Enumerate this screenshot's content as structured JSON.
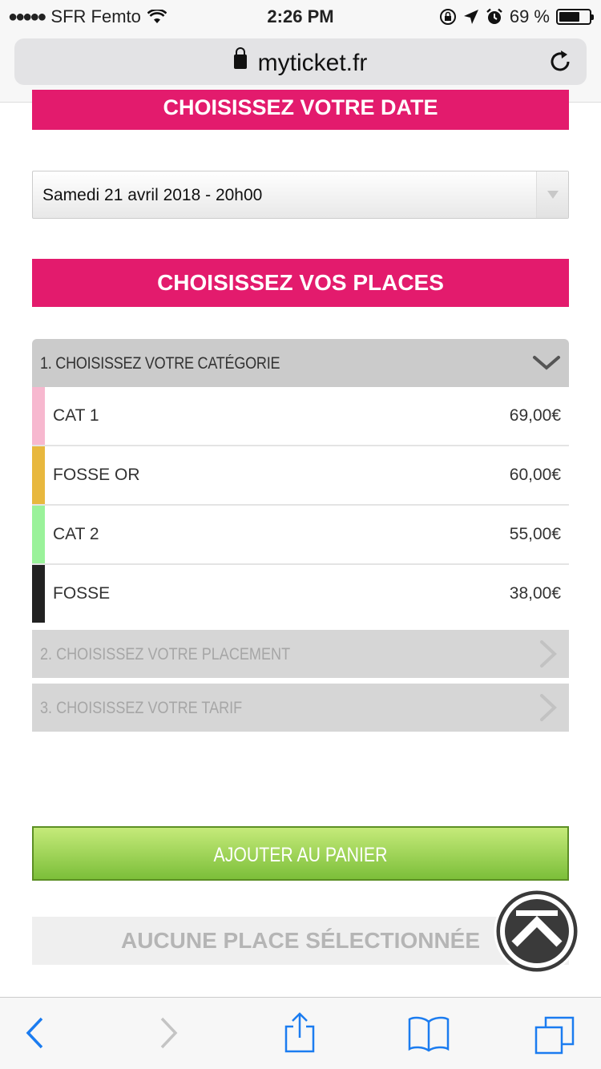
{
  "status_bar": {
    "carrier": "SFR Femto",
    "time": "2:26 PM",
    "battery_percent": "69 %",
    "battery_level": 0.69
  },
  "browser": {
    "url": "myticket.fr"
  },
  "page": {
    "date_header": "CHOISISSEZ VOTRE DATE",
    "date_select_value": "Samedi 21 avril 2018 - 20h00",
    "places_header": "CHOISISSEZ VOS PLACES",
    "step1_label": "1. CHOISISSEZ VOTRE CATÉGORIE",
    "categories": [
      {
        "name": "CAT 1",
        "price": "69,00€",
        "color": "#f7b8cf"
      },
      {
        "name": "FOSSE OR",
        "price": "60,00€",
        "color": "#e8b83e"
      },
      {
        "name": "CAT 2",
        "price": "55,00€",
        "color": "#9af29a"
      },
      {
        "name": "FOSSE",
        "price": "38,00€",
        "color": "#222222"
      }
    ],
    "step2_label": "2. CHOISISSEZ VOTRE PLACEMENT",
    "step3_label": "3. CHOISISSEZ VOTRE TARIF",
    "add_to_cart_label": "AJOUTER AU PANIER",
    "no_seat_label": "AUCUNE PLACE SÉLECTIONNÉE"
  },
  "colors": {
    "accent_pink": "#e31b6d",
    "cart_green": "#7cbf3a",
    "ios_blue": "#1b7cf0"
  },
  "icons": {
    "back": "chevron-left-icon",
    "forward": "chevron-right-icon",
    "share": "share-icon",
    "bookmarks": "book-icon",
    "tabs": "tabs-icon",
    "scroll_top": "scroll-to-top-icon"
  }
}
